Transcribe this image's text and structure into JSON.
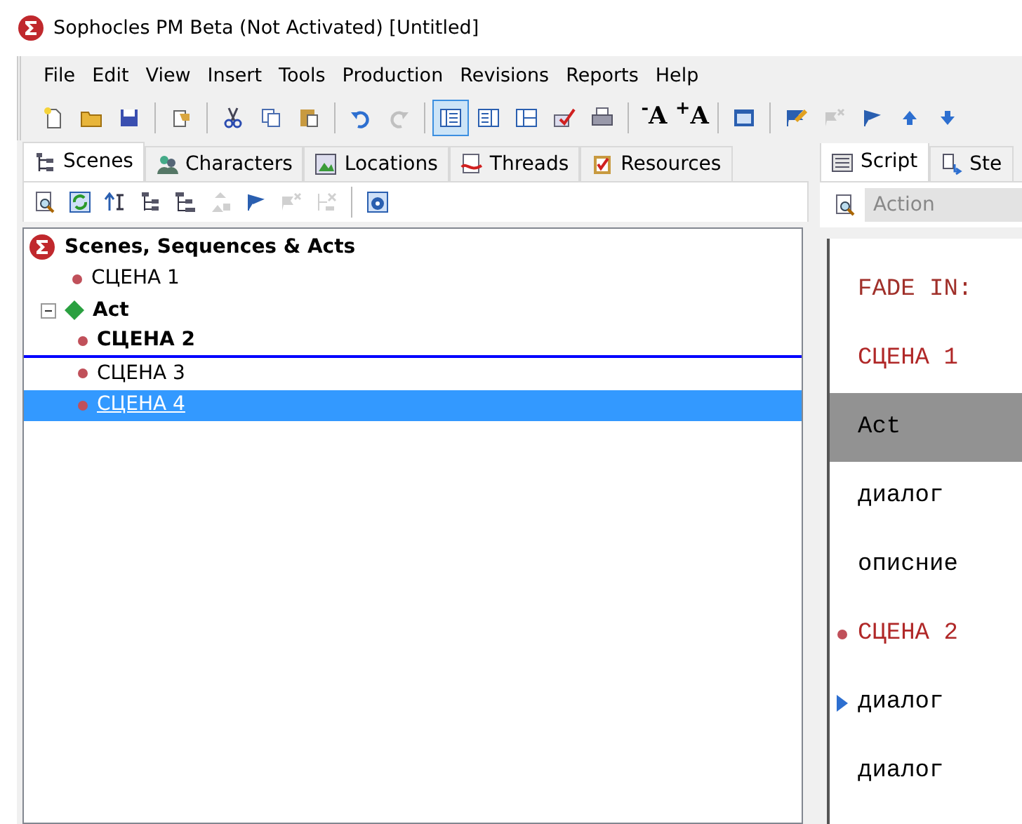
{
  "window": {
    "title": "Sophocles PM Beta (Not Activated)   [Untitled]"
  },
  "menu": [
    "File",
    "Edit",
    "View",
    "Insert",
    "Tools",
    "Production",
    "Revisions",
    "Reports",
    "Help"
  ],
  "toolbar": [
    {
      "kind": "new",
      "selected": false,
      "disabled": false
    },
    {
      "kind": "open",
      "selected": false,
      "disabled": false
    },
    {
      "kind": "save",
      "selected": false,
      "disabled": false
    },
    {
      "kind": "sep"
    },
    {
      "kind": "props",
      "selected": false,
      "disabled": false
    },
    {
      "kind": "sep"
    },
    {
      "kind": "cut",
      "selected": false,
      "disabled": false
    },
    {
      "kind": "copy",
      "selected": false,
      "disabled": false
    },
    {
      "kind": "paste",
      "selected": false,
      "disabled": false
    },
    {
      "kind": "sep"
    },
    {
      "kind": "undo",
      "selected": false,
      "disabled": false
    },
    {
      "kind": "redo",
      "selected": false,
      "disabled": true
    },
    {
      "kind": "sep"
    },
    {
      "kind": "layout1",
      "selected": true,
      "disabled": false
    },
    {
      "kind": "layout2",
      "selected": false,
      "disabled": false
    },
    {
      "kind": "layout3",
      "selected": false,
      "disabled": false
    },
    {
      "kind": "check",
      "selected": false,
      "disabled": false
    },
    {
      "kind": "printer",
      "selected": false,
      "disabled": false
    },
    {
      "kind": "sep"
    },
    {
      "kind": "text",
      "label": "$^{-}$A",
      "selected": false,
      "disabled": false
    },
    {
      "kind": "text",
      "label": "$^{+}$A",
      "selected": false,
      "disabled": false
    },
    {
      "kind": "sep"
    },
    {
      "kind": "window",
      "selected": false,
      "disabled": false
    },
    {
      "kind": "sep"
    },
    {
      "kind": "flagpen",
      "selected": false,
      "disabled": false
    },
    {
      "kind": "flagx",
      "selected": false,
      "disabled": true
    },
    {
      "kind": "flag",
      "selected": false,
      "disabled": false
    },
    {
      "kind": "up",
      "selected": false,
      "disabled": false
    },
    {
      "kind": "down",
      "selected": false,
      "disabled": false
    }
  ],
  "left_tabs": [
    {
      "label": "Scenes",
      "kind": "tree",
      "selected": true
    },
    {
      "label": "Characters",
      "kind": "people",
      "selected": false
    },
    {
      "label": "Locations",
      "kind": "map",
      "selected": false
    },
    {
      "label": "Threads",
      "kind": "thread",
      "selected": false
    },
    {
      "label": "Resources",
      "kind": "clip",
      "selected": false
    }
  ],
  "scene_toolbar": [
    {
      "kind": "find",
      "disabled": false
    },
    {
      "kind": "refresh",
      "disabled": false
    },
    {
      "kind": "sort",
      "disabled": false
    },
    {
      "kind": "tree1",
      "disabled": false
    },
    {
      "kind": "tree2",
      "disabled": false
    },
    {
      "kind": "move",
      "disabled": true
    },
    {
      "kind": "flag",
      "disabled": false
    },
    {
      "kind": "flagx",
      "disabled": true
    },
    {
      "kind": "treex",
      "disabled": true
    },
    {
      "kind": "sep"
    },
    {
      "kind": "help",
      "disabled": false
    }
  ],
  "scene_tree": {
    "label": "Scenes, Sequences & Acts",
    "children": [
      {
        "label": "СЦЕНА 1",
        "kind": "scene",
        "bold": false,
        "selected": false,
        "drop_line_after": false
      },
      {
        "label": "Act",
        "kind": "act",
        "expanded": true,
        "children": [
          {
            "label": "СЦЕНА 2",
            "kind": "scene",
            "bold": true,
            "selected": false,
            "drop_line_after": true
          },
          {
            "label": "СЦЕНА 3",
            "kind": "scene",
            "bold": false,
            "selected": false,
            "drop_line_after": false
          },
          {
            "label": "СЦЕНА 4",
            "kind": "scene",
            "bold": false,
            "selected": true,
            "drop_line_after": false
          }
        ]
      }
    ]
  },
  "right_tabs": [
    {
      "label": "Script",
      "kind": "script",
      "selected": true
    },
    {
      "label": "Ste",
      "kind": "step",
      "selected": false
    }
  ],
  "element_field": {
    "value": "Action"
  },
  "script": [
    {
      "text": "FADE IN:",
      "kind": "transition",
      "highlighted": false,
      "dot": false,
      "caret": false
    },
    {
      "text": "СЦЕНА 1",
      "kind": "scene",
      "highlighted": false,
      "dot": false,
      "caret": false
    },
    {
      "text": "Act",
      "kind": "act",
      "highlighted": true,
      "dot": false,
      "caret": false
    },
    {
      "text": "диалог",
      "kind": "dialog",
      "highlighted": false,
      "dot": false,
      "caret": false
    },
    {
      "text": "описние",
      "kind": "action",
      "highlighted": false,
      "dot": false,
      "caret": false
    },
    {
      "text": "СЦЕНА 2",
      "kind": "scene",
      "highlighted": false,
      "dot": true,
      "caret": false
    },
    {
      "text": "диалог",
      "kind": "dialog",
      "highlighted": false,
      "dot": false,
      "caret": true
    },
    {
      "text": "диалог",
      "kind": "dialog",
      "highlighted": false,
      "dot": false,
      "caret": false
    }
  ]
}
